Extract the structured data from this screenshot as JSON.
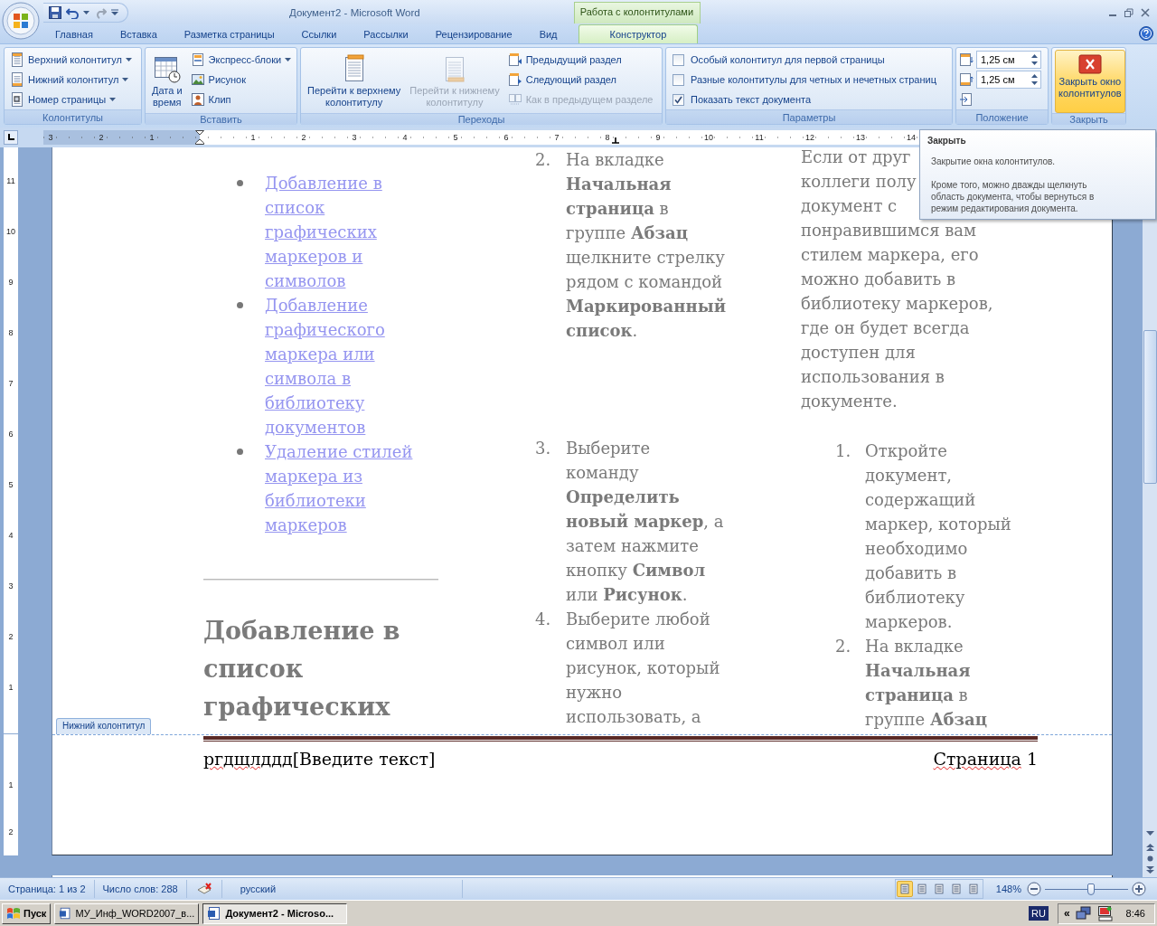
{
  "title_bar": {
    "title": "Документ2 - Microsoft Word",
    "context_group": "Работа с колонтитулами"
  },
  "tabs": [
    {
      "label": "Главная",
      "selected": false,
      "kind": "standard"
    },
    {
      "label": "Вставка",
      "selected": false,
      "kind": "standard"
    },
    {
      "label": "Разметка страницы",
      "selected": false,
      "kind": "standard"
    },
    {
      "label": "Ссылки",
      "selected": false,
      "kind": "standard"
    },
    {
      "label": "Рассылки",
      "selected": false,
      "kind": "standard"
    },
    {
      "label": "Рецензирование",
      "selected": false,
      "kind": "standard"
    },
    {
      "label": "Вид",
      "selected": false,
      "kind": "standard"
    },
    {
      "label": "Конструктор",
      "selected": true,
      "kind": "contextual"
    }
  ],
  "ribbon": [
    {
      "title": "Колонтитулы",
      "controls": [
        {
          "kind": "small",
          "label": "Верхний колонтитул",
          "dropdown": true,
          "disabled": false
        },
        {
          "kind": "small",
          "label": "Нижний колонтитул",
          "dropdown": true,
          "disabled": false
        },
        {
          "kind": "small",
          "label": "Номер страницы",
          "dropdown": true,
          "disabled": false
        }
      ]
    },
    {
      "title": "Вставить",
      "controls": [
        {
          "kind": "large",
          "label_lines": [
            "Дата и",
            "время"
          ],
          "disabled": false,
          "hovered": false
        },
        {
          "kind": "small",
          "label": "Экспресс-блоки",
          "dropdown": true,
          "disabled": false
        },
        {
          "kind": "small",
          "label": "Рисунок",
          "dropdown": false,
          "disabled": false
        },
        {
          "kind": "small",
          "label": "Клип",
          "dropdown": false,
          "disabled": false
        }
      ]
    },
    {
      "title": "Переходы",
      "controls": [
        {
          "kind": "large",
          "label_lines": [
            "Перейти к верхнему",
            "колонтитулу"
          ],
          "disabled": false,
          "hovered": false
        },
        {
          "kind": "large",
          "label_lines": [
            "Перейти к нижнему",
            "колонтитулу"
          ],
          "disabled": true,
          "hovered": false
        },
        {
          "kind": "small",
          "label": "Предыдущий раздел",
          "dropdown": false,
          "disabled": false
        },
        {
          "kind": "small",
          "label": "Следующий раздел",
          "dropdown": false,
          "disabled": false
        },
        {
          "kind": "small",
          "label": "Как в предыдущем разделе",
          "dropdown": false,
          "disabled": true
        }
      ]
    },
    {
      "title": "Параметры",
      "controls": [
        {
          "kind": "checkbox",
          "label": "Особый колонтитул для первой страницы",
          "checked": false
        },
        {
          "kind": "checkbox",
          "label": "Разные колонтитулы для четных и нечетных страниц",
          "checked": false
        },
        {
          "kind": "checkbox",
          "label": "Показать текст документа",
          "checked": true
        }
      ]
    },
    {
      "title": "Положение",
      "controls": [
        {
          "kind": "spin",
          "value": "1,25 см"
        },
        {
          "kind": "spin",
          "value": "1,25 см"
        },
        {
          "kind": "icon"
        }
      ]
    },
    {
      "title": "Закрыть",
      "controls": [
        {
          "kind": "large",
          "label_lines": [
            "Закрыть окно",
            "колонтитулов"
          ],
          "disabled": false,
          "hovered": true
        }
      ]
    }
  ],
  "ruler": {
    "left_numbers": [
      "3",
      "2",
      "1"
    ],
    "right_numbers": [
      "1",
      "2",
      "3",
      "4",
      "5",
      "6",
      "7",
      "8",
      "9",
      "10",
      "11",
      "12",
      "13",
      "14"
    ]
  },
  "vertical_ruler": {
    "body_numbers": [
      "11",
      "10",
      "9",
      "8",
      "7",
      "6",
      "5",
      "4",
      "3",
      "2",
      "1"
    ],
    "footer_numbers": [
      "1",
      "2"
    ]
  },
  "document": {
    "columns": [
      {
        "blocks": [
          {
            "kind": "bullet_link",
            "lines": [
              "Добавление в",
              "список",
              "графических",
              "маркеров и",
              "символов"
            ]
          },
          {
            "kind": "bullet_link",
            "lines": [
              "Добавление",
              "графического",
              "маркера или",
              "символа в",
              "библиотеку",
              "документов"
            ]
          },
          {
            "kind": "bullet_link",
            "lines": [
              "Удаление стилей",
              "маркера из",
              "библиотеки",
              "маркеров"
            ]
          },
          {
            "kind": "rule"
          },
          {
            "kind": "heading",
            "lines": [
              "Добавление в",
              "список",
              "графических"
            ]
          }
        ]
      },
      {
        "blocks": [
          {
            "kind": "numbered",
            "number": "2.",
            "lines": [
              "На вкладке",
              "**Начальная**",
              "**страница** в",
              "группе **Абзац**",
              "щелкните стрелку",
              "рядом с командой",
              "**Маркированный**",
              "**список**."
            ]
          },
          {
            "kind": "numbered",
            "number": "3.",
            "lines": [
              "Выберите",
              "команду",
              "**Определить**",
              "**новый маркер**, а",
              "затем нажмите",
              "кнопку **Символ**",
              "или **Рисунок**."
            ]
          },
          {
            "kind": "numbered",
            "number": "4.",
            "lines": [
              "Выберите любой",
              "символ или",
              "рисунок, который",
              "нужно",
              "использовать, а"
            ]
          }
        ]
      },
      {
        "blocks": [
          {
            "kind": "paragraph",
            "lines": [
              "Если от друг",
              "коллеги полу",
              "документ с",
              "понравившимся вам",
              "стилем маркера, его",
              "можно добавить в",
              "библиотеку маркеров,",
              "где он будет всегда",
              "доступен для",
              "использования в",
              "документе."
            ]
          },
          {
            "kind": "numbered",
            "number": "1.",
            "lines": [
              "Откройте",
              "документ,",
              "содержащий",
              "маркер, который",
              "необходимо",
              "добавить в",
              "библиотеку",
              "маркеров."
            ]
          },
          {
            "kind": "numbered",
            "number": "2.",
            "lines": [
              "На вкладке",
              "**Начальная**",
              "**страница** в",
              "группе **Абзац**"
            ]
          }
        ]
      }
    ],
    "footer": {
      "label": "Нижний колонтитул",
      "typed_text": "ргдщлддд",
      "prompt_text": "[Введите текст]",
      "page_label": "Страница",
      "page_number": "1"
    }
  },
  "tooltip": {
    "title": "Закрыть",
    "lines": [
      "Закрытие окна колонтитулов.",
      "Кроме того, можно дважды щелкнуть область документа, чтобы вернуться в режим редактирования документа."
    ]
  },
  "status_bar": {
    "page": "Страница: 1 из 2",
    "words": "Число слов: 288",
    "language": "русский",
    "views": [
      {
        "selected": true
      },
      {
        "selected": false
      },
      {
        "selected": false
      },
      {
        "selected": false
      },
      {
        "selected": false
      }
    ],
    "zoom": {
      "reading": "148%",
      "level": 0.55
    }
  },
  "taskbar": {
    "start": "Пуск",
    "tasks": [
      {
        "label": "МУ_Инф_WORD2007_в...",
        "selected": false
      },
      {
        "label": "Документ2 - Microso...",
        "selected": true
      }
    ],
    "language": "RU",
    "tray_chevron": "«",
    "clock": "8:46"
  }
}
